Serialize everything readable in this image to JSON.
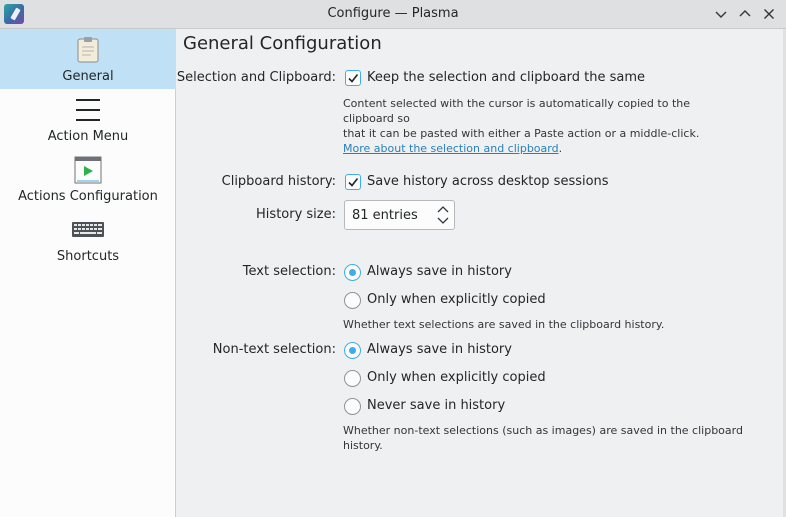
{
  "window": {
    "title": "Configure — Plasma"
  },
  "sidebar": {
    "items": [
      {
        "label": "General",
        "icon": "clipboard-icon"
      },
      {
        "label": "Action Menu",
        "icon": "menu-icon"
      },
      {
        "label": "Actions Configuration",
        "icon": "play-window-icon"
      },
      {
        "label": "Shortcuts",
        "icon": "keyboard-icon"
      }
    ]
  },
  "main": {
    "title": "General Configuration",
    "selection_clipboard": {
      "label": "Selection and Clipboard:",
      "checkbox_label": "Keep the selection and clipboard the same",
      "checked": true,
      "help_line1": "Content selected with the cursor is automatically copied to the clipboard so",
      "help_line2": "that it can be pasted with either a Paste action or a middle-click.",
      "help_link": "More about the selection and clipboard",
      "help_link_suffix": "."
    },
    "clipboard_history": {
      "label": "Clipboard history:",
      "checkbox_label": "Save history across desktop sessions",
      "checked": true
    },
    "history_size": {
      "label": "History size:",
      "value": "81 entries"
    },
    "text_selection": {
      "label": "Text selection:",
      "options": [
        "Always save in history",
        "Only when explicitly copied"
      ],
      "selected": 0,
      "help": "Whether text selections are saved in the clipboard history."
    },
    "non_text_selection": {
      "label": "Non-text selection:",
      "options": [
        "Always save in history",
        "Only when explicitly copied",
        "Never save in history"
      ],
      "selected": 0,
      "help_line1": "Whether non-text selections (such as images) are saved in the clipboard",
      "help_line2": "history."
    }
  },
  "colors": {
    "accent": "#3daee9",
    "selection_bg": "#bfe0f5",
    "link": "#2980b9"
  }
}
